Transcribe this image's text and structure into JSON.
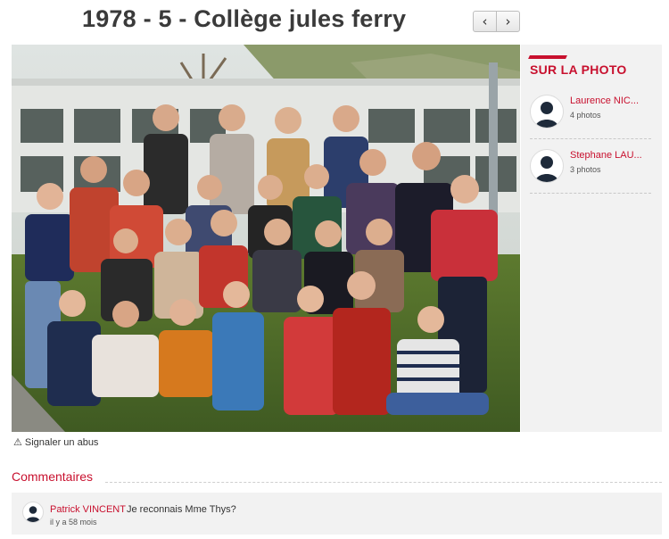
{
  "header": {
    "title": "1978 - 5 - Collège jules ferry",
    "prev_icon": "‹",
    "next_icon": "›"
  },
  "photo": {
    "subject": "class-group-photo"
  },
  "sidebar": {
    "title": "SUR LA PHOTO",
    "accent_color": "#c8102e",
    "people": [
      {
        "name": "Laurence NIC...",
        "count": "4 photos"
      },
      {
        "name": "Stephane LAU...",
        "count": "3 photos"
      }
    ]
  },
  "report": {
    "icon": "⚠",
    "label": "Signaler un abus"
  },
  "comments": {
    "title": "Commentaires",
    "items": [
      {
        "author": "Patrick VINCENT",
        "text": "Je reconnais Mme Thys?",
        "time": "il y a 58 mois"
      }
    ]
  }
}
